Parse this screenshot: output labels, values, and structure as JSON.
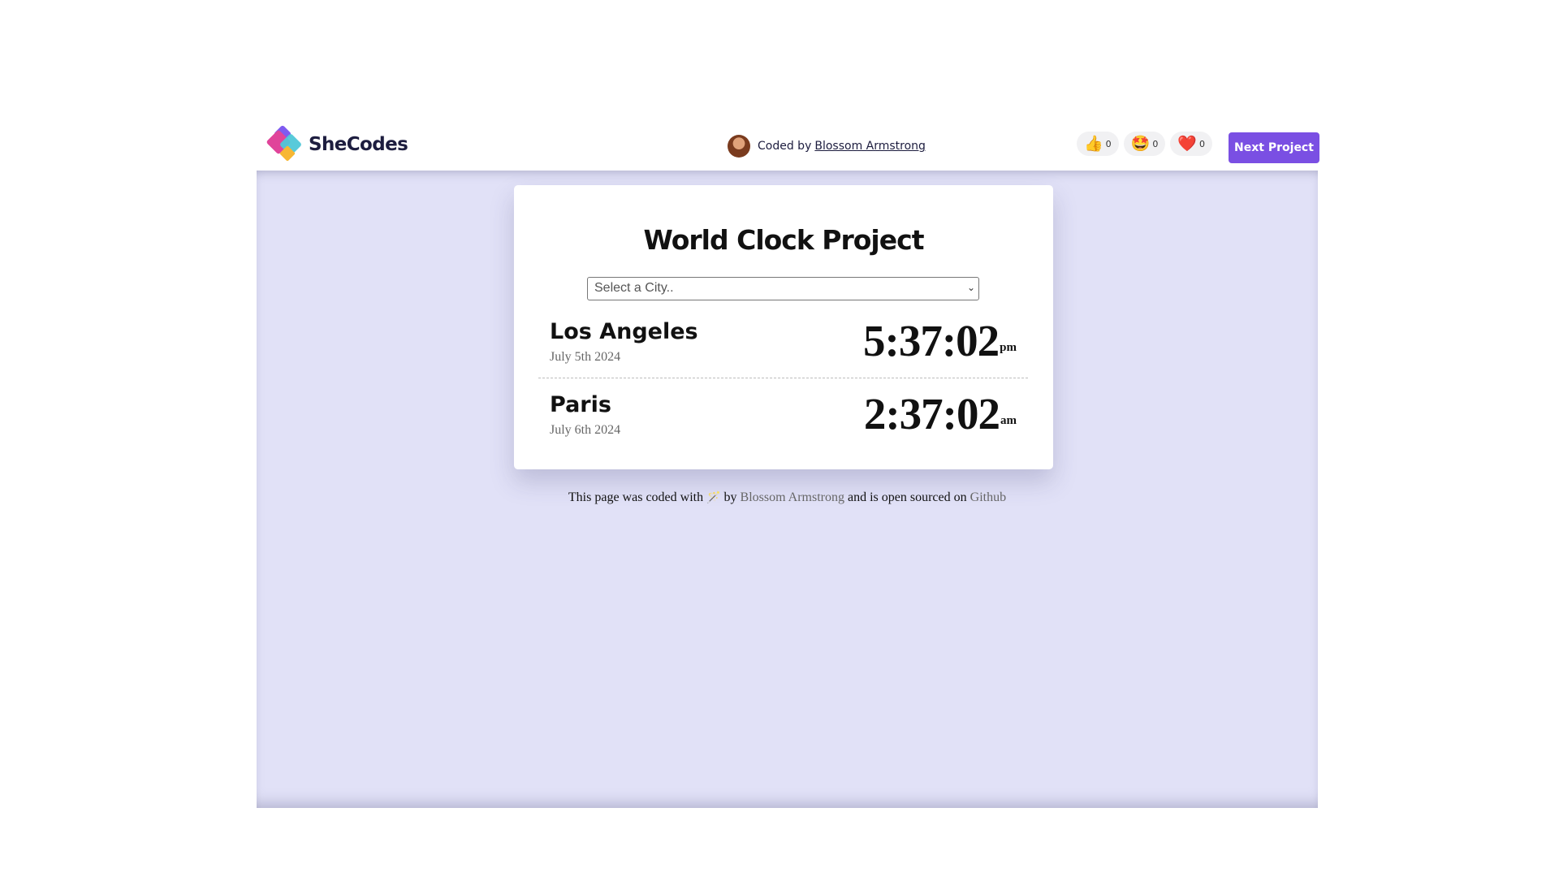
{
  "header": {
    "logo_text": "SheCodes",
    "coded_prefix": "Coded by",
    "author": "Blossom Armstrong",
    "reactions": [
      {
        "icon": "thumbs-up-icon",
        "emoji": "👍",
        "count": "0"
      },
      {
        "icon": "star-struck-icon",
        "emoji": "🤩",
        "count": "0"
      },
      {
        "icon": "heart-icon",
        "emoji": "❤️",
        "count": "0"
      }
    ],
    "next_button": "Next Project"
  },
  "card": {
    "title": "World Clock Project",
    "select_placeholder": "Select a City..",
    "cities": [
      {
        "name": "Los Angeles",
        "date": "July 5th 2024",
        "time": "5:37:02",
        "ampm": "pm"
      },
      {
        "name": "Paris",
        "date": "July 6th 2024",
        "time": "2:37:02",
        "ampm": "am"
      }
    ]
  },
  "footer": {
    "text_before": "This page was coded with",
    "wand_icon": "magic-wand-icon",
    "text_by": "by",
    "author_link": "Blossom Armstrong",
    "text_open": "and is open sourced on",
    "github_link": "Github"
  },
  "colors": {
    "accent": "#7a4fe3",
    "background": "#e1e1f7"
  }
}
